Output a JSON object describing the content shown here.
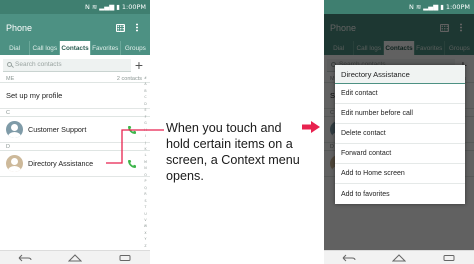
{
  "colors": {
    "accent": "#4d9183",
    "status_bar": "#3f7f70",
    "call_icon": "#3cb54a",
    "pointer_arrow": "#e8224f"
  },
  "status": {
    "time": "1:00PM"
  },
  "app": {
    "title": "Phone"
  },
  "tabs": [
    {
      "label": "Dial"
    },
    {
      "label": "Call logs"
    },
    {
      "label": "Contacts"
    },
    {
      "label": "Favorites"
    },
    {
      "label": "Groups"
    }
  ],
  "active_tab": "Contacts",
  "search": {
    "placeholder": "Search contacts"
  },
  "list": {
    "me_header": "ME",
    "count": "2 contacts",
    "profile": "Set up my profile",
    "sections": [
      {
        "letter": "C",
        "contact": "Customer Support"
      },
      {
        "letter": "D",
        "contact": "Directory Assistance"
      }
    ]
  },
  "index_letters": [
    "#",
    "A",
    "B",
    "C",
    "D",
    "E",
    "F",
    "G",
    "H",
    "I",
    "J",
    "K",
    "L",
    "M",
    "N",
    "O",
    "P",
    "Q",
    "R",
    "S",
    "T",
    "U",
    "V",
    "W",
    "X",
    "Y",
    "Z"
  ],
  "callout": "When you touch and hold certain items on a screen, a Context menu opens.",
  "context_menu": {
    "title": "Directory Assistance",
    "items": [
      "Edit contact",
      "Edit number before call",
      "Delete contact",
      "Forward contact",
      "Add to Home screen",
      "Add to favorites"
    ]
  },
  "icons": {
    "search": "search-icon",
    "add": "add-icon",
    "dialpad": "dialpad-icon",
    "overflow": "overflow-menu-icon",
    "call": "call-icon",
    "back": "back-icon",
    "home": "home-icon",
    "recents": "recents-icon"
  }
}
